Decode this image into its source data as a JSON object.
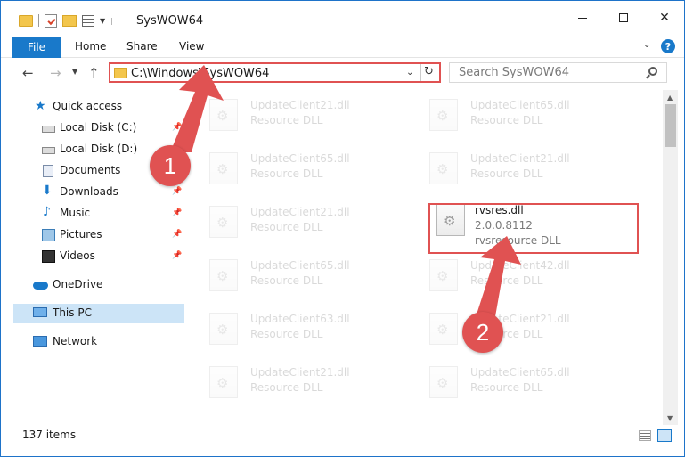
{
  "window": {
    "title": "SysWOW64",
    "accent": "#1979ca",
    "highlight_color": "#e05252"
  },
  "ribbon": {
    "tabs": [
      {
        "label": "File"
      },
      {
        "label": "Home"
      },
      {
        "label": "Share"
      },
      {
        "label": "View"
      }
    ],
    "help": "?"
  },
  "nav": {
    "address": "C:\\Windows\\SysWOW64",
    "search_placeholder": "Search SysWOW64"
  },
  "sidebar": {
    "items": [
      {
        "label": "Quick access",
        "icon": "star-icon"
      },
      {
        "label": "Local Disk (C:)",
        "icon": "disk-icon"
      },
      {
        "label": "Local Disk (D:)",
        "icon": "disk-icon"
      },
      {
        "label": "Documents",
        "icon": "documents-icon"
      },
      {
        "label": "Downloads",
        "icon": "downloads-icon"
      },
      {
        "label": "Music",
        "icon": "music-icon"
      },
      {
        "label": "Pictures",
        "icon": "pictures-icon"
      },
      {
        "label": "Videos",
        "icon": "videos-icon"
      },
      {
        "label": "OneDrive",
        "icon": "onedrive-icon"
      },
      {
        "label": "This PC",
        "icon": "this-pc-icon"
      },
      {
        "label": "Network",
        "icon": "network-icon"
      }
    ]
  },
  "files": {
    "left": [
      {
        "name": "UpdateClient21.dll",
        "desc": "Resource DLL"
      },
      {
        "name": "UpdateClient65.dll",
        "desc": "Resource DLL"
      },
      {
        "name": "UpdateClient21.dll",
        "desc": "Resource DLL"
      },
      {
        "name": "UpdateClient65.dll",
        "desc": "Resource DLL"
      },
      {
        "name": "UpdateClient63.dll",
        "desc": "Resource DLL"
      },
      {
        "name": "UpdateClient21.dll",
        "desc": "Resource DLL"
      }
    ],
    "right": [
      {
        "name": "UpdateClient65.dll",
        "desc": "Resource DLL"
      },
      {
        "name": "UpdateClient21.dll",
        "desc": "Resource DLL"
      },
      {
        "name": "UpdateClient42.dll",
        "desc": "Resource DLL"
      },
      {
        "name": "UpdateClient21.dll",
        "desc": "Resource DLL"
      },
      {
        "name": "UpdateClient65.dll",
        "desc": "Resource DLL"
      }
    ],
    "highlighted": {
      "name": "rvsres.dll",
      "version": "2.0.0.8112",
      "desc": "rvsresource DLL"
    }
  },
  "status": {
    "items_count": "137 items"
  },
  "callouts": {
    "step1": "1",
    "step2": "2"
  }
}
